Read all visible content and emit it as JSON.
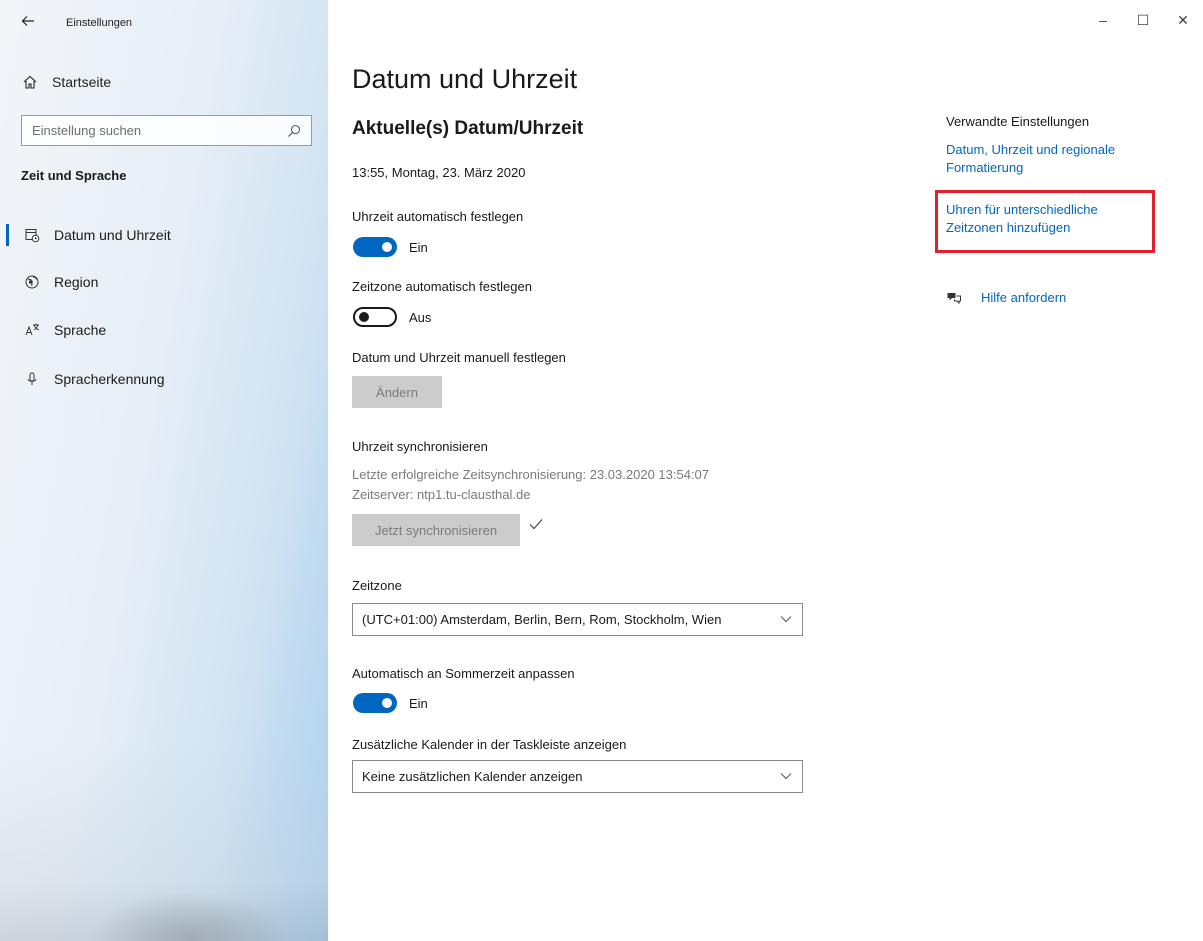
{
  "window": {
    "title": "Einstellungen",
    "controls": {
      "minimize": "–",
      "maximize": "☐",
      "close": "✕"
    }
  },
  "sidebar": {
    "home_label": "Startseite",
    "search_placeholder": "Einstellung suchen",
    "section_title": "Zeit und Sprache",
    "items": [
      {
        "label": "Datum und Uhrzeit",
        "icon": "calendar-clock-icon",
        "selected": true
      },
      {
        "label": "Region",
        "icon": "globe-icon",
        "selected": false
      },
      {
        "label": "Sprache",
        "icon": "language-icon",
        "selected": false
      },
      {
        "label": "Spracherkennung",
        "icon": "microphone-icon",
        "selected": false
      }
    ]
  },
  "main": {
    "page_title": "Datum und Uhrzeit",
    "current_heading": "Aktuelle(s) Datum/Uhrzeit",
    "current_datetime": "13:55, Montag, 23. März 2020",
    "auto_time": {
      "label": "Uhrzeit automatisch festlegen",
      "state": "Ein"
    },
    "auto_timezone": {
      "label": "Zeitzone automatisch festlegen",
      "state": "Aus"
    },
    "manual": {
      "label": "Datum und Uhrzeit manuell festlegen",
      "button": "Ändern"
    },
    "sync": {
      "heading": "Uhrzeit synchronisieren",
      "last_sync": "Letzte erfolgreiche Zeitsynchronisierung: 23.03.2020 13:54:07",
      "server": "Zeitserver: ntp1.tu-clausthal.de",
      "button": "Jetzt synchronisieren"
    },
    "timezone": {
      "label": "Zeitzone",
      "value": "(UTC+01:00) Amsterdam, Berlin, Bern, Rom, Stockholm, Wien"
    },
    "dst": {
      "label": "Automatisch an Sommerzeit anpassen",
      "state": "Ein"
    },
    "calendar": {
      "label": "Zusätzliche Kalender in der Taskleiste anzeigen",
      "value": "Keine zusätzlichen Kalender anzeigen"
    }
  },
  "related": {
    "title": "Verwandte Einstellungen",
    "link1_line1": "Datum, Uhrzeit und regionale",
    "link1_line2": "Formatierung",
    "link2_line1": "Uhren für unterschiedliche",
    "link2_line2": "Zeitzonen hinzufügen",
    "help": "Hilfe anfordern"
  },
  "colors": {
    "accent": "#0067c0",
    "highlight": "#e0202c"
  }
}
